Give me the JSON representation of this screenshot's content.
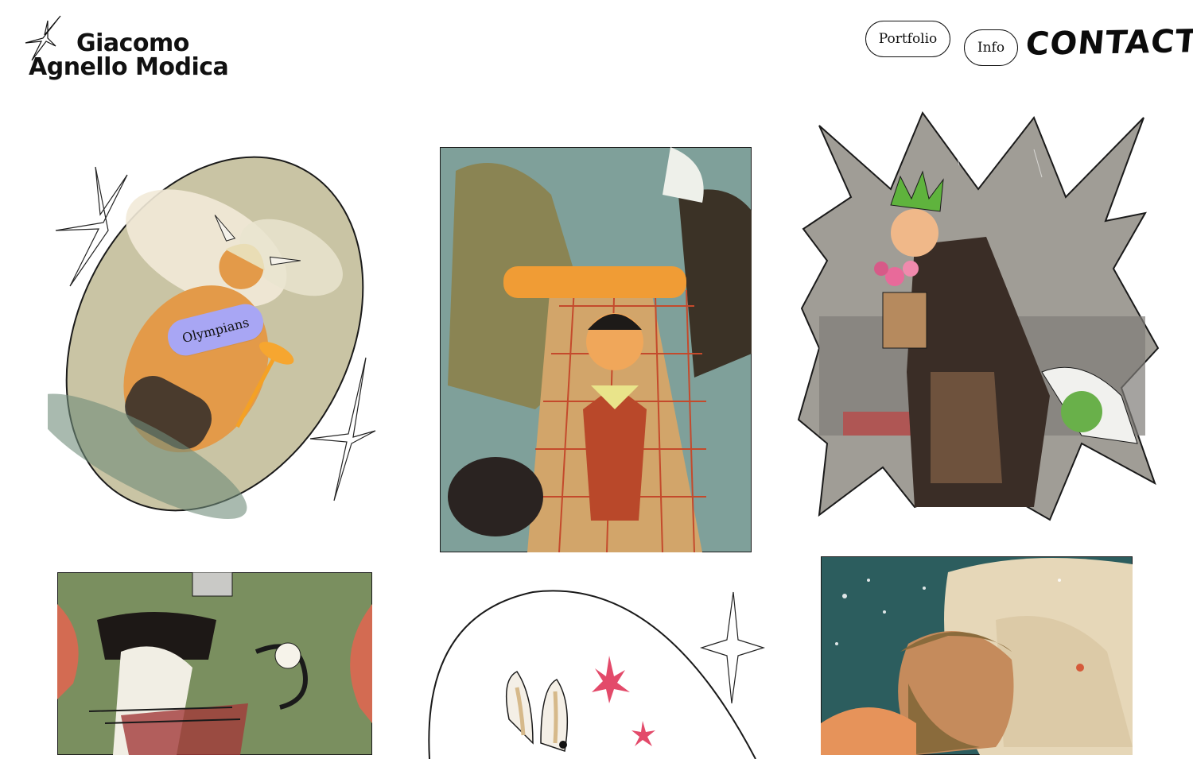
{
  "header": {
    "logo_line1": "Giacomo",
    "logo_line2": "Agnello Modica"
  },
  "nav": {
    "portfolio": "Portfolio",
    "info": "Info",
    "contact": "CONTACT"
  },
  "gallery": {
    "items": [
      {
        "hover_label": "Olympians"
      }
    ]
  },
  "colors": {
    "background": "#ffffff",
    "tag": "#a8a6f4",
    "ink": "#111111"
  }
}
